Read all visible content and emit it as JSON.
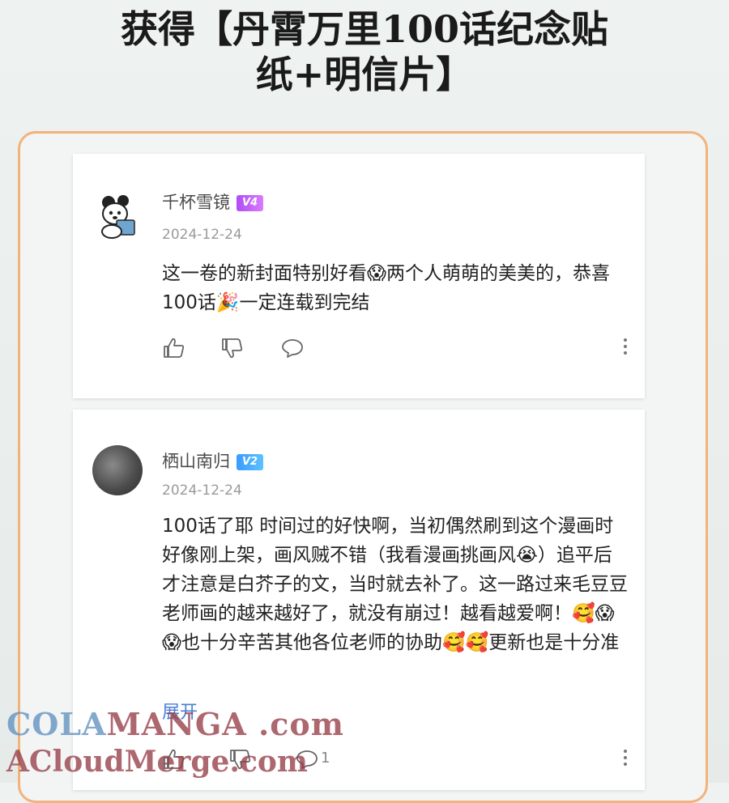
{
  "headline": {
    "line1": "获得【丹霄万里100话纪念贴",
    "line2": "纸+明信片】"
  },
  "comments": [
    {
      "username": "千杯雪镜",
      "level": "V4",
      "date": "2024-12-24",
      "text": "这一卷的新封面特别好看😱两个人萌萌的美美的，恭喜100话🎉一定连载到完结",
      "icons": [
        "thumbs-up-icon",
        "thumbs-down-icon",
        "comment-icon",
        "more-icon"
      ]
    },
    {
      "username": "栖山南归",
      "level": "V2",
      "date": "2024-12-24",
      "text": "100话了耶 时间过的好快啊，当初偶然刷到这个漫画时好像刚上架，画风贼不错（我看漫画挑画风😭）追平后才注意是白芥子的文，当时就去补了。这一路过来毛豆豆老师画的越来越好了，就没有崩过！越看越爱啊！🥰😱😱也十分辛苦其他各位老师的协助🥰🥰更新也是十分准",
      "expand_label": "展开",
      "comment_count": "1",
      "icons": [
        "thumbs-up-icon",
        "thumbs-down-icon",
        "comment-icon",
        "more-icon"
      ]
    }
  ],
  "watermark": {
    "line1_a": "COLA",
    "line1_b": "MANGA .com",
    "line2": "ACloudMerge.com"
  },
  "colors": {
    "frame_border": "#f2b27c",
    "v4_badge": "#b14cf5",
    "v2_badge": "#3a9bff",
    "expand_link": "#4a7fd6"
  }
}
